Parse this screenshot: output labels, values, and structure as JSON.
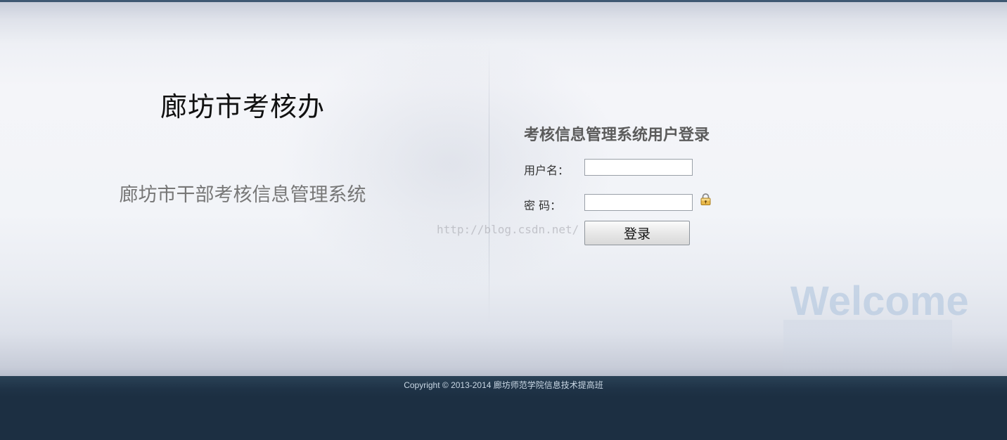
{
  "branding": {
    "title": "廊坊市考核办",
    "system_name": "廊坊市干部考核信息管理系统"
  },
  "login": {
    "title": "考核信息管理系统用户登录",
    "username_label": "用户名：",
    "password_label": "密 码：",
    "username_value": "",
    "password_value": "",
    "submit_label": "登录"
  },
  "decor": {
    "watermark_url": "http://blog.csdn.net/",
    "welcome_text": "Welcome",
    "lock_icon": "lock-icon"
  },
  "footer": {
    "copyright": "Copyright © 2013-2014 廊坊师范学院信息技术提高班"
  },
  "colors": {
    "footer_bg": "#1c2f42",
    "login_title": "#5b5b5b",
    "welcome": "#b4c8de"
  }
}
